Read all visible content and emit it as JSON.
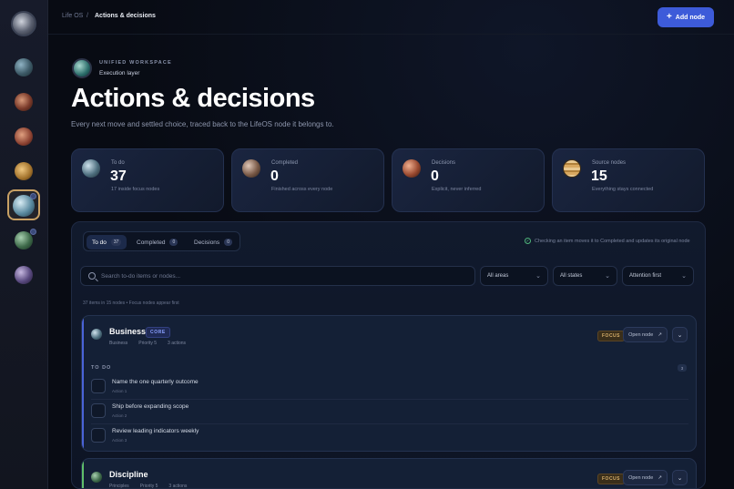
{
  "breadcrumb": {
    "root": "Life OS",
    "separator": "/",
    "current": "Actions & decisions"
  },
  "add_node_button": "Add node",
  "workspace": {
    "eyebrow": "UNIFIED WORKSPACE",
    "name": "Execution layer"
  },
  "page": {
    "title": "Actions & decisions",
    "description": "Every next move and settled choice, traced back to the LifeOS node it belongs to."
  },
  "stats": [
    {
      "label": "To do",
      "value": "37",
      "sub": "17 inside focus nodes"
    },
    {
      "label": "Completed",
      "value": "0",
      "sub": "Finished across every node"
    },
    {
      "label": "Decisions",
      "value": "0",
      "sub": "Explicit, never inferred"
    },
    {
      "label": "Source nodes",
      "value": "15",
      "sub": "Everything stays connected"
    }
  ],
  "tabs": [
    {
      "label": "To do",
      "count": "37",
      "active": true
    },
    {
      "label": "Completed",
      "count": "0",
      "active": false
    },
    {
      "label": "Decisions",
      "count": "0",
      "active": false
    }
  ],
  "hint": "Checking an item moves it to Completed and updates its original node",
  "search": {
    "placeholder": "Search to-do items or nodes..."
  },
  "filters": {
    "area": "All areas",
    "state": "All states",
    "sort": "Attention first"
  },
  "list_meta": "37 items in 15 nodes  •  Focus nodes appear first",
  "groups": [
    {
      "title": "Business",
      "badge": "CORE",
      "meta": [
        "Business",
        "Priority 5",
        "3 actions"
      ],
      "focus": "FOCUS",
      "open_label": "Open node",
      "section_label": "TO DO",
      "section_count": "3",
      "items": [
        {
          "title": "Name the one quarterly outcome",
          "sub": "Action 1"
        },
        {
          "title": "Ship before expanding scope",
          "sub": "Action 2"
        },
        {
          "title": "Review leading indicators weekly",
          "sub": "Action 3"
        }
      ]
    },
    {
      "title": "Discipline",
      "meta": [
        "Principles",
        "Priority 5",
        "3 actions"
      ],
      "focus": "FOCUS",
      "open_label": "Open node"
    }
  ],
  "colors": {
    "accent": "#3d5bd9",
    "focus": "#d6ae6a",
    "business_accent": "#4a63d8",
    "discipline_accent": "#5fbf6a"
  },
  "icons": {
    "add": "plus-icon",
    "search": "search-icon",
    "open": "arrow-up-right-icon",
    "expand": "chevron-down-icon",
    "check": "check-circle-icon"
  }
}
